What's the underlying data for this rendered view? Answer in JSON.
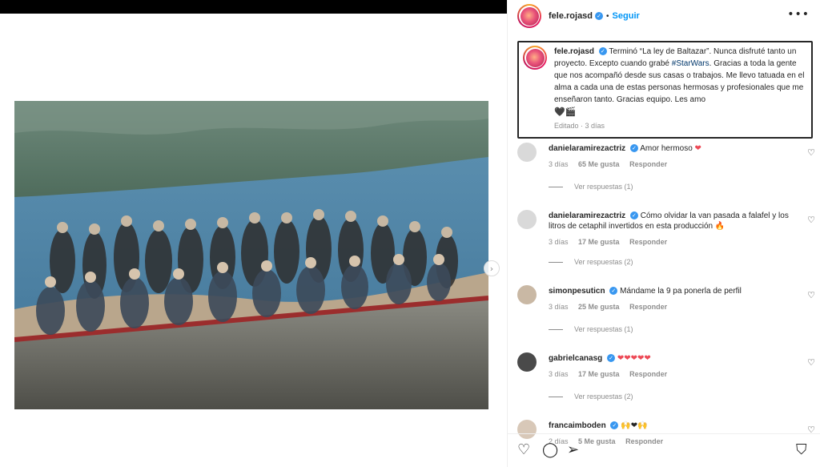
{
  "header": {
    "username": "fele.rojasd",
    "separator": "•",
    "follow_label": "Seguir",
    "more_label": "•••"
  },
  "caption": {
    "username": "fele.rojasd",
    "text_1": "Terminó “La ley de Baltazar”. Nunca disfruté tanto un proyecto. Excepto cuando grabé ",
    "hashtag": "#StarWars",
    "text_2": ". Gracias a toda la gente que nos acompañó desde sus casas o trabajos. Me llevo tatuada en el alma a cada una de estas personas hermosas y profesionales que me enseñaron tanto. Gracias equipo. Les amo",
    "emojis": "🖤🎬",
    "edited": "Editado · 3 días"
  },
  "comments": [
    {
      "username": "danielaramirezactriz",
      "text": "Amor hermoso ",
      "emoji": "❤",
      "time": "3 días",
      "likes": "65 Me gusta",
      "reply": "Responder",
      "replies": "Ver respuestas (1)",
      "avatar_color": "#d9d9d9"
    },
    {
      "username": "danielaramirezactriz",
      "text": "Cómo olvidar la van pasada a falafel y los litros de cetaphil invertidos en esta producción ",
      "emoji": "🔥",
      "time": "3 días",
      "likes": "17 Me gusta",
      "reply": "Responder",
      "replies": "Ver respuestas (2)",
      "avatar_color": "#d9d9d9"
    },
    {
      "username": "simonpesuticn",
      "text": "Mándame la 9 pa ponerla de perfil",
      "emoji": "",
      "time": "3 días",
      "likes": "25 Me gusta",
      "reply": "Responder",
      "replies": "Ver respuestas (1)",
      "avatar_color": "#c9b8a4"
    },
    {
      "username": "gabrielcanasg",
      "text": "",
      "emoji": "❤❤❤❤❤",
      "time": "3 días",
      "likes": "17 Me gusta",
      "reply": "Responder",
      "replies": "Ver respuestas (2)",
      "avatar_color": "#4a4a4a"
    },
    {
      "username": "francaimboden",
      "text": "",
      "emoji": "🙌❤🙌",
      "time": "2 días",
      "likes": "5 Me gusta",
      "reply": "Responder",
      "replies": "",
      "avatar_color": "#d8c8b8"
    }
  ],
  "actions": {
    "like_icon": "heart-outline-icon",
    "comment_icon": "comment-bubble-icon",
    "share_icon": "paper-plane-icon",
    "save_icon": "bookmark-icon"
  },
  "colors": {
    "accent": "#0095f6",
    "verified": "#3897f0",
    "hashtag": "#00376b",
    "heart_red": "#ed4956",
    "muted": "#8e8e8e"
  }
}
